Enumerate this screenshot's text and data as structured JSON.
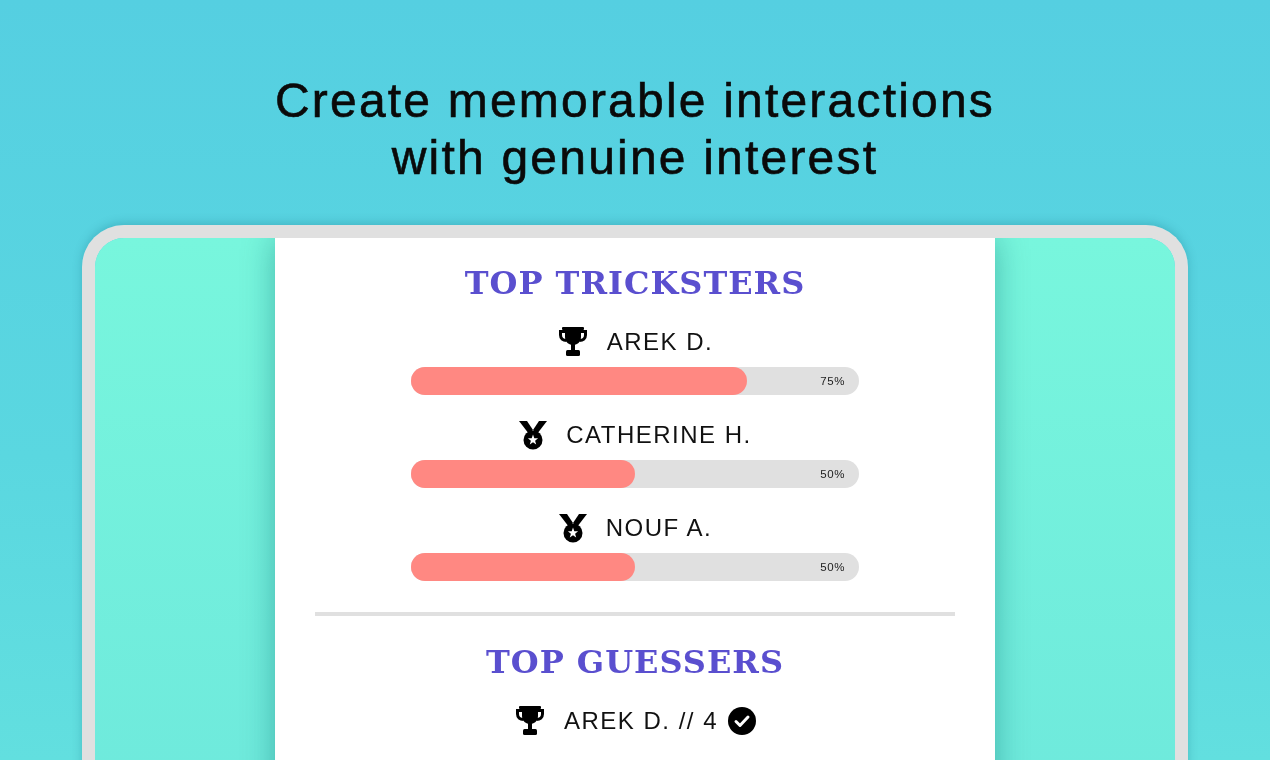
{
  "headline": "Create memorable interactions with genuine interest",
  "sections": [
    {
      "kind": "bars",
      "title": "TOP TRICKSTERS",
      "entries": [
        {
          "kind": "trophy",
          "name": "AREK D.",
          "level": 0.75,
          "reading": "75%"
        },
        {
          "kind": "medal",
          "name": "CATHERINE H.",
          "level": 0.5,
          "reading": "50%"
        },
        {
          "kind": "medal",
          "name": "NOUF A.",
          "level": 0.5,
          "reading": "50%"
        }
      ]
    },
    {
      "kind": "list",
      "title": "TOP GUESSERS",
      "entries": [
        {
          "kind": "trophy",
          "name": "AREK D. // 4",
          "checked": true
        }
      ]
    }
  ]
}
